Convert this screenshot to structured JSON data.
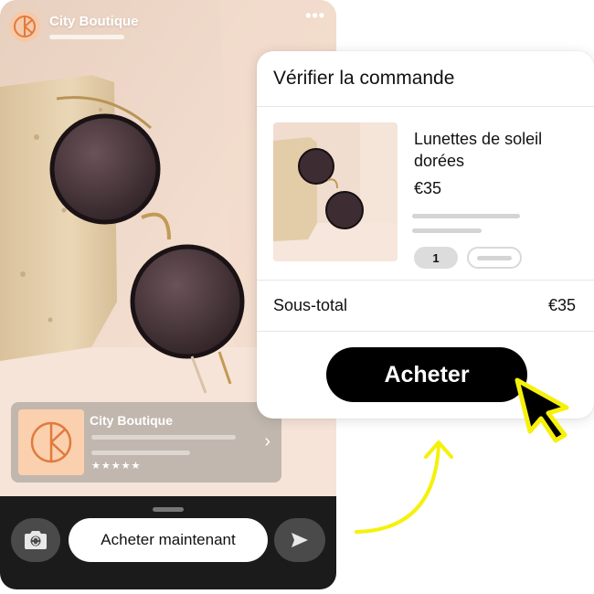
{
  "story": {
    "brand_name": "City Boutique",
    "more_label": "•••",
    "product_card": {
      "title": "City Boutique",
      "stars": "★★★★★"
    },
    "bottom_bar": {
      "buy_now_label": "Acheter maintenant"
    }
  },
  "checkout": {
    "title": "Vérifier la commande",
    "item": {
      "name": "Lunettes de soleil dorées",
      "price": "€35",
      "quantity": "1"
    },
    "subtotal_label": "Sous-total",
    "subtotal_value": "€35",
    "buy_label": "Acheter"
  },
  "colors": {
    "accent_yellow": "#f6f10b",
    "brand_peach": "#f6c9a8",
    "button_black": "#000000"
  },
  "icons": {
    "avatar": "boutique-logo-icon",
    "more": "more-dots-icon",
    "camera": "camera-icon",
    "send": "send-icon",
    "cursor": "cursor-pointer-icon"
  }
}
